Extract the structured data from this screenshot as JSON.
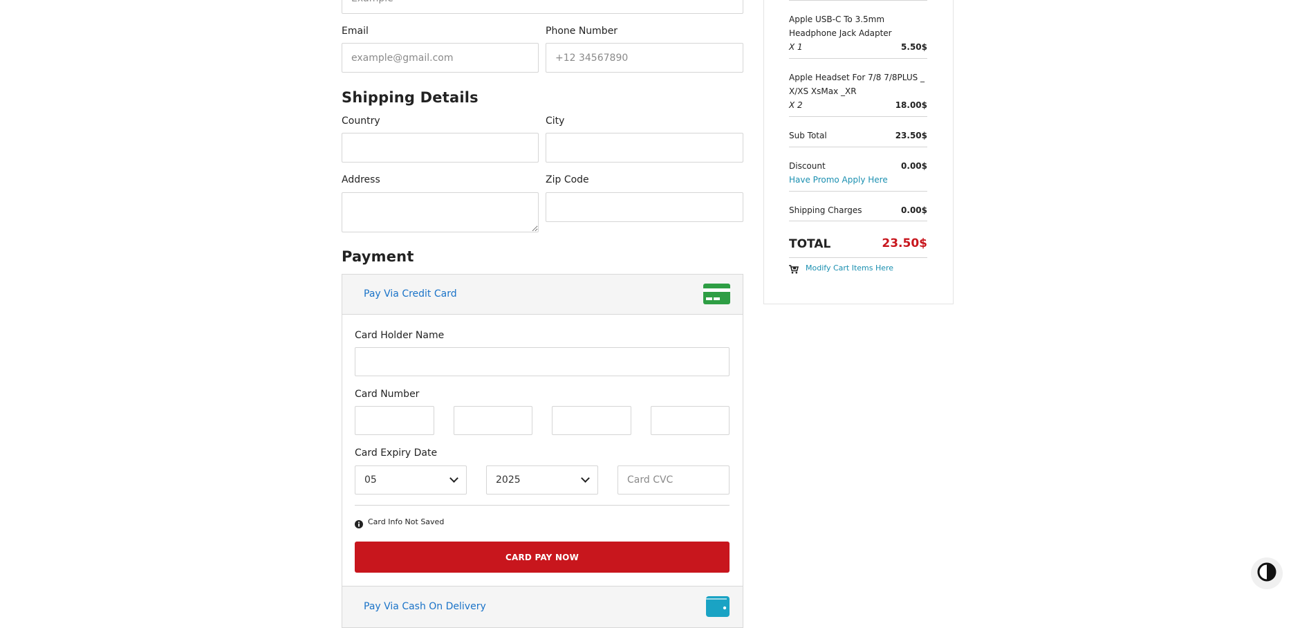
{
  "contact": {
    "name_placeholder": "Example",
    "email_label": "Email",
    "email_placeholder": "example@gmail.com",
    "phone_label": "Phone Number",
    "phone_placeholder": "+12 34567890"
  },
  "shipping": {
    "title": "Shipping Details",
    "country_label": "Country",
    "city_label": "City",
    "address_label": "Address",
    "zip_label": "Zip Code"
  },
  "payment": {
    "title": "Payment",
    "credit_option": "Pay Via Credit Card",
    "cardholder_label": "Card Holder Name",
    "card_number_label": "Card Number",
    "expiry_label": "Card Expiry Date",
    "expiry_month": "05",
    "expiry_year": "2025",
    "cvc_placeholder": "Card CVC",
    "info_note": "Card Info Not Saved",
    "pay_button": "CARD PAY NOW",
    "cod_option": "Pay Via Cash On Delivery"
  },
  "summary": {
    "items": [
      {
        "name_line1": "Apple USB-C To 3.5mm",
        "name_line2": "Headphone Jack Adapter",
        "qty": "X 1",
        "price": "5.50$"
      },
      {
        "name_line1": "Apple Headset For 7/8 7/8PLUS _",
        "name_line2": "X/XS XsMax _XR",
        "qty": "X 2",
        "price": "18.00$"
      }
    ],
    "subtotal_label": "Sub Total",
    "subtotal_value": "23.50$",
    "discount_label": "Discount",
    "discount_value": "0.00$",
    "promo_link": "Have Promo Apply Here",
    "shipping_label": "Shipping Charges",
    "shipping_value": "0.00$",
    "total_label": "TOTAL",
    "total_value": "23.50$",
    "modify_link": "Modify Cart Items Here"
  },
  "colors": {
    "accent_red": "#c8161d",
    "link_blue": "#1a73c8",
    "card_icon_green": "#2e9e44",
    "wallet_icon_teal": "#1aa3c4"
  },
  "icons": [
    "credit-card-icon",
    "info-icon",
    "wallet-icon",
    "cart-icon",
    "contrast-icon",
    "chevron-down-icon"
  ]
}
